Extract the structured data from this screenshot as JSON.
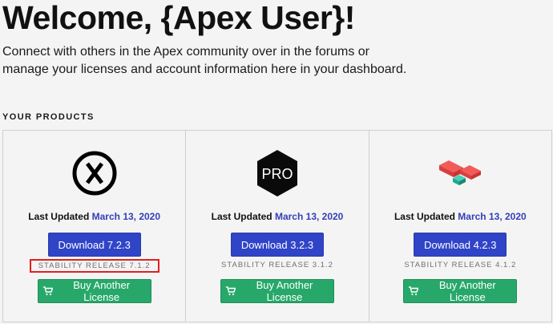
{
  "page": {
    "title": "Welcome, {Apex User}!",
    "intro": "Connect with others in the Apex community over in the forums or manage your licenses and account information here in your dashboard.",
    "section_label": "YOUR PRODUCTS"
  },
  "products": [
    {
      "logo_icon": "x-circle-logo-icon",
      "updated_label": "Last Updated",
      "updated_date": "March 13, 2020",
      "download_label": "Download 7.2.3",
      "release": "STABILITY RELEASE 7.1.2",
      "release_highlighted": true,
      "buy_label": "Buy Another License"
    },
    {
      "logo_icon": "pro-hexagon-logo-icon",
      "logo_text": "PRO",
      "updated_label": "Last Updated",
      "updated_date": "March 13, 2020",
      "download_label": "Download 3.2.3",
      "release": "STABILITY RELEASE 3.1.2",
      "release_highlighted": false,
      "buy_label": "Buy Another License"
    },
    {
      "logo_icon": "blocks-logo-icon",
      "updated_label": "Last Updated",
      "updated_date": "March 13, 2020",
      "download_label": "Download 4.2.3",
      "release": "STABILITY RELEASE 4.1.2",
      "release_highlighted": false,
      "buy_label": "Buy Another License"
    }
  ],
  "colors": {
    "download_button": "#3044c8",
    "buy_button": "#27a86a",
    "date_link": "#3340b5",
    "highlight_box": "#e02020"
  }
}
